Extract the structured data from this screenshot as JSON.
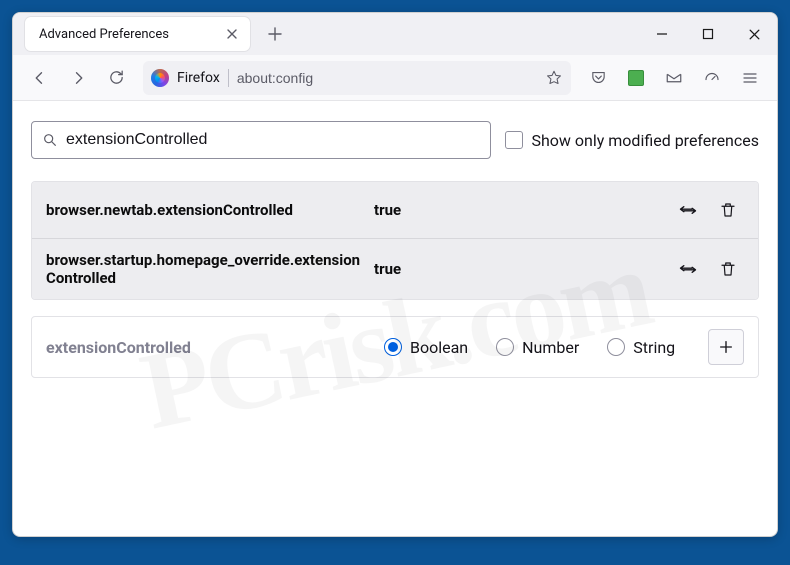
{
  "tab": {
    "title": "Advanced Preferences"
  },
  "url": {
    "brand": "Firefox",
    "address": "about:config"
  },
  "search": {
    "query": "extensionControlled",
    "modified_label": "Show only modified preferences"
  },
  "prefs": [
    {
      "name": "browser.newtab.extensionControlled",
      "value": "true"
    },
    {
      "name": "browser.startup.homepage_override.extensionControlled",
      "value": "true"
    }
  ],
  "create": {
    "name": "extensionControlled",
    "options": [
      "Boolean",
      "Number",
      "String"
    ],
    "selected": 0
  }
}
